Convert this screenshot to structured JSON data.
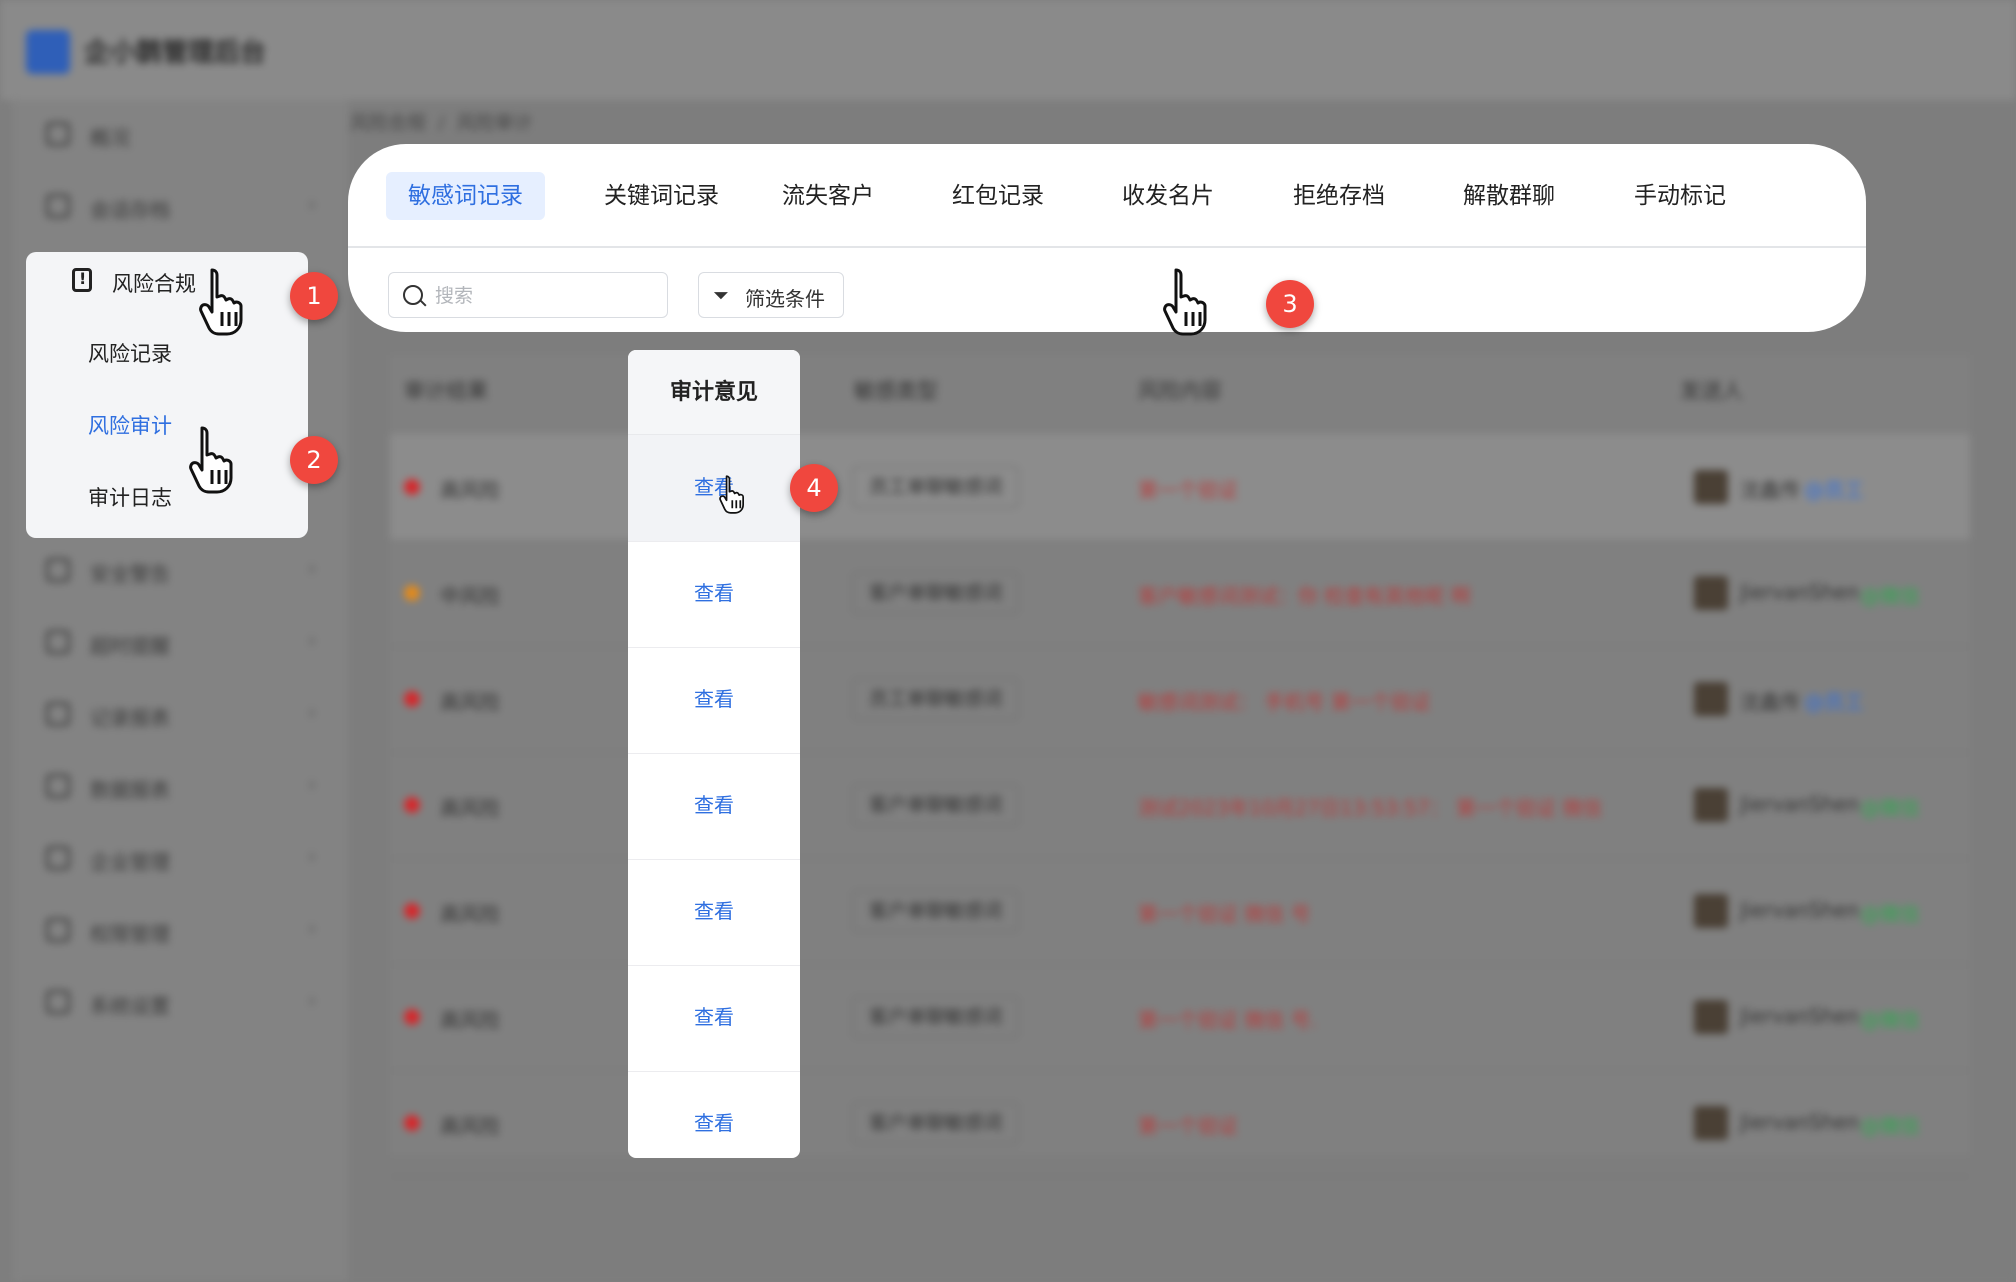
{
  "app": {
    "title": "企小鹊管理后台"
  },
  "breadcrumb": [
    "风险合规",
    "风险审计"
  ],
  "sidebar": {
    "items": [
      {
        "label": "概况"
      },
      {
        "label": "会话存档"
      },
      {
        "label": "风险合规"
      },
      {
        "label": "安全警告"
      },
      {
        "label": "超时提醒"
      },
      {
        "label": "记录报表"
      },
      {
        "label": "数据报表"
      },
      {
        "label": "企业管理"
      },
      {
        "label": "权限管理"
      },
      {
        "label": "系统设置"
      }
    ]
  },
  "risk_menu": {
    "title": "风险合规",
    "children": [
      {
        "label": "风险记录",
        "active": false
      },
      {
        "label": "风险审计",
        "active": true
      },
      {
        "label": "审计日志",
        "active": false
      }
    ]
  },
  "tabs": [
    {
      "label": "敏感词记录",
      "active": true
    },
    {
      "label": "关键词记录"
    },
    {
      "label": "流失客户"
    },
    {
      "label": "红包记录"
    },
    {
      "label": "收发名片"
    },
    {
      "label": "拒绝存档"
    },
    {
      "label": "解散群聊"
    },
    {
      "label": "手动标记"
    }
  ],
  "search": {
    "placeholder": "搜索"
  },
  "filter": {
    "label": "筛选条件"
  },
  "table": {
    "columns": [
      "审计结果",
      "审计意见",
      "敏感类型",
      "风险内容",
      "发送人"
    ],
    "rows": [
      {
        "result": "高风险",
        "result_color": "#d4282c",
        "opinion": "查看",
        "type": "员工单聊敏感词",
        "content": "第一个验证",
        "sender": "沈鑫传",
        "sender_tag": "@员工",
        "sender_tag_color": "#2f6fe0"
      },
      {
        "result": "中风险",
        "result_color": "#e08a1e",
        "opinion": "查看",
        "type": "客户单聊敏感词",
        "content": "客户敏感词测试：你 检查有其他呢 啊",
        "sender": "JiervanShen",
        "sender_tag": "@微信",
        "sender_tag_color": "#2fa84f"
      },
      {
        "result": "高风险",
        "result_color": "#d4282c",
        "opinion": "查看",
        "type": "员工单聊敏感词",
        "content": "敏感词测试： 手机号 第一个验证",
        "sender": "沈鑫传",
        "sender_tag": "@员工",
        "sender_tag_color": "#2f6fe0"
      },
      {
        "result": "高风险",
        "result_color": "#d4282c",
        "opinion": "查看",
        "type": "客户单聊敏感词",
        "content": "测试2023年10月27日13:53:57： 第一个验证 微信",
        "sender": "JiervanShen",
        "sender_tag": "@微信",
        "sender_tag_color": "#2fa84f"
      },
      {
        "result": "高风险",
        "result_color": "#d4282c",
        "opinion": "查看",
        "type": "客户单聊敏感词",
        "content": "第一个验证 微信 号",
        "sender": "JiervanShen",
        "sender_tag": "@微信",
        "sender_tag_color": "#2fa84f"
      },
      {
        "result": "高风险",
        "result_color": "#d4282c",
        "opinion": "查看",
        "type": "客户单聊敏感词",
        "content": "第一个验证 微信 号.",
        "sender": "JiervanShen",
        "sender_tag": "@微信",
        "sender_tag_color": "#2fa84f"
      },
      {
        "result": "高风险",
        "result_color": "#d4282c",
        "opinion": "查看",
        "type": "客户单聊敏感词",
        "content": "第一个验证",
        "sender": "JiervanShen",
        "sender_tag": "@微信",
        "sender_tag_color": "#2fa84f"
      }
    ]
  },
  "steps": [
    "1",
    "2",
    "3",
    "4"
  ],
  "colors": {
    "accent": "#2f6fe0",
    "badge": "#f0473e"
  }
}
